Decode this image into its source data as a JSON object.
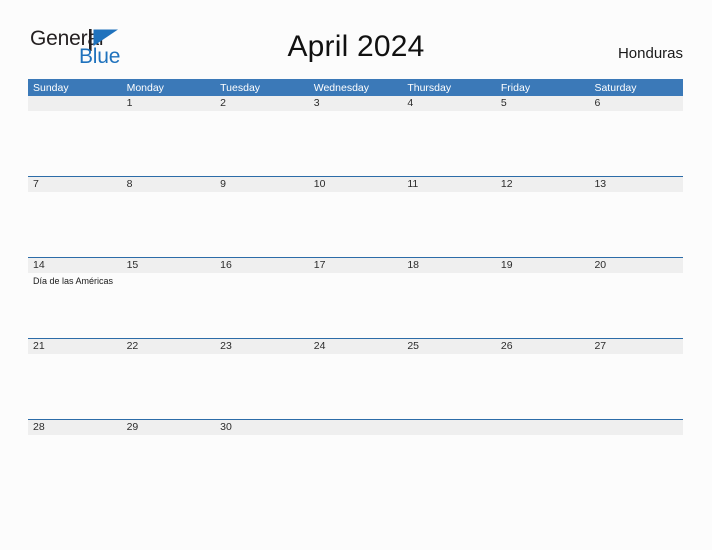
{
  "brand": {
    "name_part1": "General",
    "name_part2": "Blue",
    "mark_icon": "flag-triangle-icon",
    "color_dark": "#231f20",
    "color_blue": "#1f72bd"
  },
  "header": {
    "title": "April 2024",
    "country": "Honduras"
  },
  "theme": {
    "header_blue": "#3b79b8",
    "rule_blue": "#2c6ca8",
    "row_gray": "#efefef",
    "page_background": "#fcfcfc"
  },
  "calendar": {
    "month": "April",
    "year": "2024",
    "weekday_headers": [
      "Sunday",
      "Monday",
      "Tuesday",
      "Wednesday",
      "Thursday",
      "Friday",
      "Saturday"
    ],
    "weeks": [
      {
        "days": [
          {
            "date": "",
            "events": []
          },
          {
            "date": "1",
            "events": []
          },
          {
            "date": "2",
            "events": []
          },
          {
            "date": "3",
            "events": []
          },
          {
            "date": "4",
            "events": []
          },
          {
            "date": "5",
            "events": []
          },
          {
            "date": "6",
            "events": []
          }
        ]
      },
      {
        "days": [
          {
            "date": "7",
            "events": []
          },
          {
            "date": "8",
            "events": []
          },
          {
            "date": "9",
            "events": []
          },
          {
            "date": "10",
            "events": []
          },
          {
            "date": "11",
            "events": []
          },
          {
            "date": "12",
            "events": []
          },
          {
            "date": "13",
            "events": []
          }
        ]
      },
      {
        "days": [
          {
            "date": "14",
            "events": [
              "Día de las Américas"
            ]
          },
          {
            "date": "15",
            "events": []
          },
          {
            "date": "16",
            "events": []
          },
          {
            "date": "17",
            "events": []
          },
          {
            "date": "18",
            "events": []
          },
          {
            "date": "19",
            "events": []
          },
          {
            "date": "20",
            "events": []
          }
        ]
      },
      {
        "days": [
          {
            "date": "21",
            "events": []
          },
          {
            "date": "22",
            "events": []
          },
          {
            "date": "23",
            "events": []
          },
          {
            "date": "24",
            "events": []
          },
          {
            "date": "25",
            "events": []
          },
          {
            "date": "26",
            "events": []
          },
          {
            "date": "27",
            "events": []
          }
        ]
      },
      {
        "days": [
          {
            "date": "28",
            "events": []
          },
          {
            "date": "29",
            "events": []
          },
          {
            "date": "30",
            "events": []
          },
          {
            "date": "",
            "events": []
          },
          {
            "date": "",
            "events": []
          },
          {
            "date": "",
            "events": []
          },
          {
            "date": "",
            "events": []
          }
        ]
      }
    ]
  }
}
